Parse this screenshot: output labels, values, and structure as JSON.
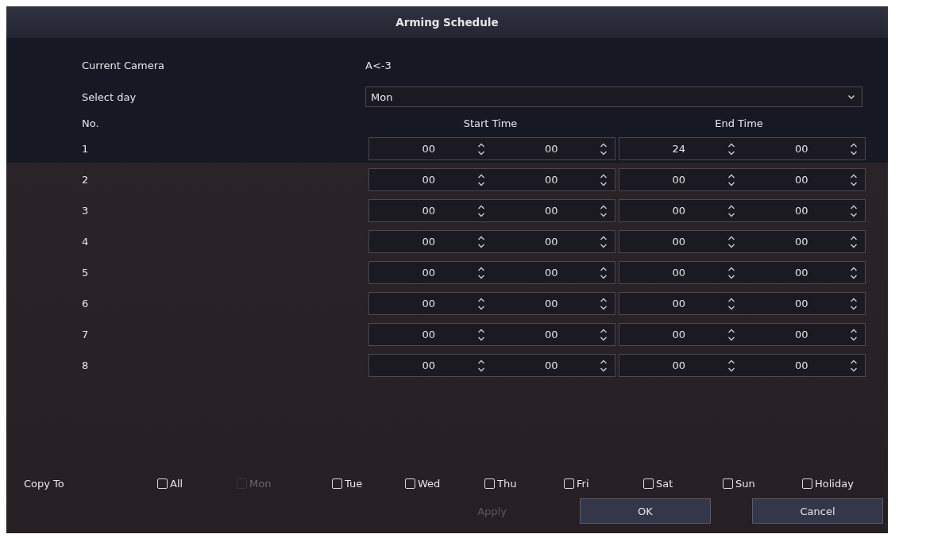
{
  "window": {
    "title": "Arming Schedule"
  },
  "camera": {
    "label": "Current Camera",
    "value": "A<-3"
  },
  "day": {
    "label": "Select day",
    "value": "Mon"
  },
  "table": {
    "columns": [
      "No.",
      "Start Time",
      "End Time"
    ],
    "rows": [
      {
        "no": "1",
        "start_hour": "00",
        "start_minute": "00",
        "end_hour": "24",
        "end_minute": "00"
      },
      {
        "no": "2",
        "start_hour": "00",
        "start_minute": "00",
        "end_hour": "00",
        "end_minute": "00"
      },
      {
        "no": "3",
        "start_hour": "00",
        "start_minute": "00",
        "end_hour": "00",
        "end_minute": "00"
      },
      {
        "no": "4",
        "start_hour": "00",
        "start_minute": "00",
        "end_hour": "00",
        "end_minute": "00"
      },
      {
        "no": "5",
        "start_hour": "00",
        "start_minute": "00",
        "end_hour": "00",
        "end_minute": "00"
      },
      {
        "no": "6",
        "start_hour": "00",
        "start_minute": "00",
        "end_hour": "00",
        "end_minute": "00"
      },
      {
        "no": "7",
        "start_hour": "00",
        "start_minute": "00",
        "end_hour": "00",
        "end_minute": "00"
      },
      {
        "no": "8",
        "start_hour": "00",
        "start_minute": "00",
        "end_hour": "00",
        "end_minute": "00"
      }
    ]
  },
  "copy_to": {
    "label": "Copy To",
    "options": [
      {
        "label": "All",
        "checked": false,
        "disabled": false
      },
      {
        "label": "Mon",
        "checked": false,
        "disabled": true
      },
      {
        "label": "Tue",
        "checked": false,
        "disabled": false
      },
      {
        "label": "Wed",
        "checked": false,
        "disabled": false
      },
      {
        "label": "Thu",
        "checked": false,
        "disabled": false
      },
      {
        "label": "Fri",
        "checked": false,
        "disabled": false
      },
      {
        "label": "Sat",
        "checked": false,
        "disabled": false
      },
      {
        "label": "Sun",
        "checked": false,
        "disabled": false
      },
      {
        "label": "Holiday",
        "checked": false,
        "disabled": false
      }
    ]
  },
  "buttons": [
    {
      "label": "Apply",
      "disabled": true
    },
    {
      "label": "OK",
      "disabled": false
    },
    {
      "label": "Cancel",
      "disabled": false
    }
  ]
}
